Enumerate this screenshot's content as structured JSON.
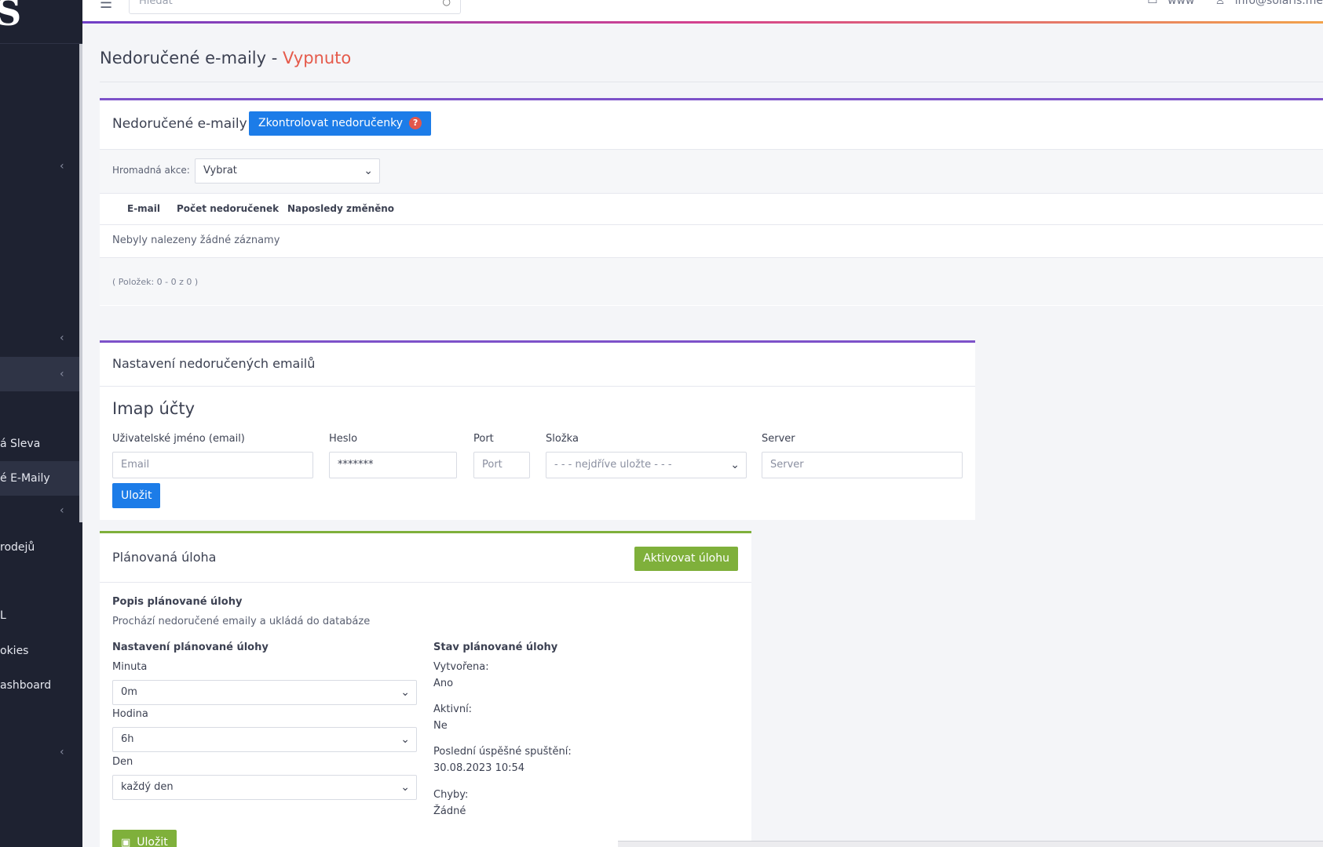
{
  "sidebar": {
    "logo_text": "S",
    "items": [
      {
        "label": "á Sleva"
      },
      {
        "label": "é E-Maily"
      },
      {
        "label": "rodejů"
      },
      {
        "label": "L"
      },
      {
        "label": "okies"
      },
      {
        "label": "ashboard"
      }
    ],
    "chevron": "‹"
  },
  "topbar": {
    "search_placeholder": "Hledat",
    "www_label": "www",
    "user_label": "info@solaris.me"
  },
  "page": {
    "title": "Nedoručené e-maily - ",
    "state": "Vypnuto"
  },
  "undelivered": {
    "title": "Nedoručené e-maily",
    "check_button": "Zkontrolovat nedoručenky",
    "help_badge": "?",
    "bulk_label": "Hromadná akce:",
    "bulk_select": "Vybrat",
    "columns": [
      "E-mail",
      "Počet nedoručenek",
      "Naposledy změněno"
    ],
    "empty_text": "Nebyly nalezeny žádné záznamy",
    "footer_text": "( Položek: 0 - 0 z 0 )"
  },
  "settings": {
    "title": "Nastavení nedoručených emailů",
    "imap_title": "Imap účty",
    "labels": {
      "user": "Uživatelské jméno (email)",
      "password": "Heslo",
      "port": "Port",
      "folder": "Složka",
      "server": "Server"
    },
    "inputs": {
      "user_placeholder": "Email",
      "password_value": "*******",
      "port_placeholder": "Port",
      "folder_value": "- - - nejdříve uložte - - -",
      "server_placeholder": "Server"
    },
    "save_button": "Uložit"
  },
  "task": {
    "title": "Plánovaná úloha",
    "activate_button": "Aktivovat úlohu",
    "desc_title": "Popis plánované úlohy",
    "desc_text": "Prochází nedoručené emaily a ukládá do databáze",
    "settings_title": "Nastavení plánované úlohy",
    "minute_label": "Minuta",
    "minute_value": "0m",
    "hour_label": "Hodina",
    "hour_value": "6h",
    "day_label": "Den",
    "day_value": "každý den",
    "status_title": "Stav plánované úlohy",
    "created_label": "Vytvořena:",
    "created_value": "Ano",
    "active_label": "Aktivní:",
    "active_value": "Ne",
    "last_run_label": "Poslední úspěšné spuštění:",
    "last_run_value": "30.08.2023 10:54",
    "errors_label": "Chyby:",
    "errors_value": "Žádné",
    "save_button": "Uložit"
  },
  "colors": {
    "sidebar_bg": "#1e2231",
    "primary": "#1c7ce8",
    "success": "#7fb03b",
    "danger": "#e55a4b",
    "purple": "#7d52c9"
  }
}
